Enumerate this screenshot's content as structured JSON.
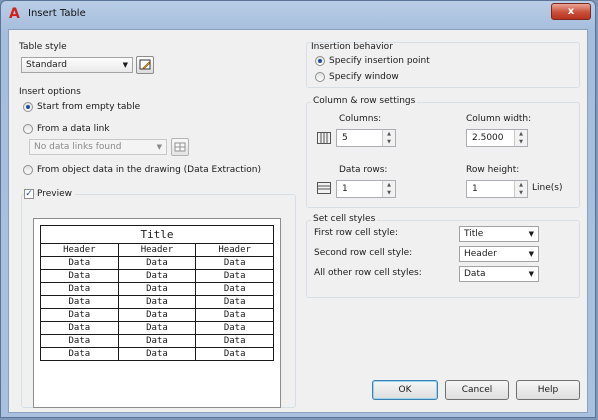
{
  "window": {
    "title": "Insert Table",
    "close_label": "x"
  },
  "table_style": {
    "group_label": "Table style",
    "selected": "Standard"
  },
  "insert_options": {
    "group_label": "Insert options",
    "start_empty": "Start from empty table",
    "from_data_link": "From a data link",
    "data_link_selected": "No data links found",
    "from_object_data": "From object data in the drawing (Data Extraction)"
  },
  "preview": {
    "checkbox_label": "Preview",
    "title": "Title",
    "headers": [
      "Header",
      "Header",
      "Header"
    ],
    "rows": [
      [
        "Data",
        "Data",
        "Data"
      ],
      [
        "Data",
        "Data",
        "Data"
      ],
      [
        "Data",
        "Data",
        "Data"
      ],
      [
        "Data",
        "Data",
        "Data"
      ],
      [
        "Data",
        "Data",
        "Data"
      ],
      [
        "Data",
        "Data",
        "Data"
      ],
      [
        "Data",
        "Data",
        "Data"
      ],
      [
        "Data",
        "Data",
        "Data"
      ]
    ]
  },
  "insertion_behavior": {
    "group_label": "Insertion behavior",
    "specify_point": "Specify insertion point",
    "specify_window": "Specify window"
  },
  "column_row": {
    "group_label": "Column & row settings",
    "columns_label": "Columns:",
    "columns_value": "5",
    "column_width_label": "Column width:",
    "column_width_value": "2.5000",
    "data_rows_label": "Data rows:",
    "data_rows_value": "1",
    "row_height_label": "Row height:",
    "row_height_value": "1",
    "row_height_unit": "Line(s)"
  },
  "cell_styles": {
    "group_label": "Set cell styles",
    "first_row_label": "First row cell style:",
    "first_row_value": "Title",
    "second_row_label": "Second row cell style:",
    "second_row_value": "Header",
    "other_rows_label": "All other row cell styles:",
    "other_rows_value": "Data"
  },
  "buttons": {
    "ok": "OK",
    "cancel": "Cancel",
    "help": "Help"
  },
  "colors": {
    "title_bar": "#a9c0de",
    "close_button": "#c9503a",
    "client_bg": "#f0f0f0",
    "radio_dot": "#1d4f9c"
  }
}
